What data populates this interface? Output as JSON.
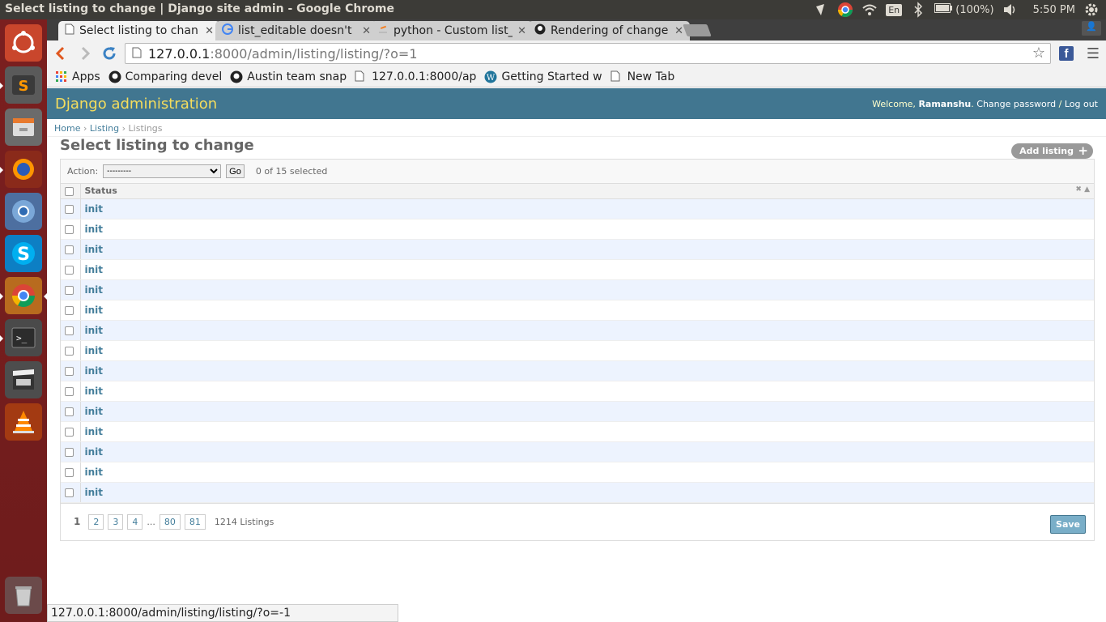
{
  "panel": {
    "window_title": "Select listing to change | Django site admin - Google Chrome",
    "keyboard": "En",
    "battery": "(100%)",
    "clock": "5:50 PM"
  },
  "launcher": {
    "items": [
      "ubuntu-dash",
      "sublime-text",
      "files",
      "firefox",
      "chromium",
      "skype",
      "chrome",
      "terminal",
      "video",
      "vlc",
      "trash"
    ]
  },
  "tabs": [
    {
      "label": "Select listing to chan",
      "active": true
    },
    {
      "label": "list_editable doesn't",
      "active": false
    },
    {
      "label": "python - Custom list_",
      "active": false
    },
    {
      "label": "Rendering of change",
      "active": false
    }
  ],
  "address": {
    "host": "127.0.0.1",
    "path": ":8000/admin/listing/listing/?o=1"
  },
  "bookmarks": [
    "Apps",
    "Comparing devel",
    "Austin team snap",
    "127.0.0.1:8000/ap",
    "Getting Started w",
    "New Tab"
  ],
  "admin": {
    "brand": "Django administration",
    "welcome": "Welcome,",
    "user": "Ramanshu",
    "change_password": "Change password",
    "separator": "/",
    "logout": "Log out"
  },
  "breadcrumbs": {
    "home": "Home",
    "app": "Listing",
    "current": "Listings"
  },
  "content": {
    "title": "Select listing to change",
    "add_button": "Add listing",
    "action_label": "Action:",
    "action_selected": "---------",
    "go_button": "Go",
    "selected_counter": "0 of 15 selected",
    "column_status": "Status",
    "rows": [
      "init",
      "init",
      "init",
      "init",
      "init",
      "init",
      "init",
      "init",
      "init",
      "init",
      "init",
      "init",
      "init",
      "init",
      "init"
    ],
    "pagination": {
      "current": "1",
      "pages": [
        "2",
        "3",
        "4"
      ],
      "ellipsis": "...",
      "tail_pages": [
        "80",
        "81"
      ],
      "total": "1214 Listings"
    },
    "save_button": "Save"
  },
  "status_url": "127.0.0.1:8000/admin/listing/listing/?o=-1"
}
